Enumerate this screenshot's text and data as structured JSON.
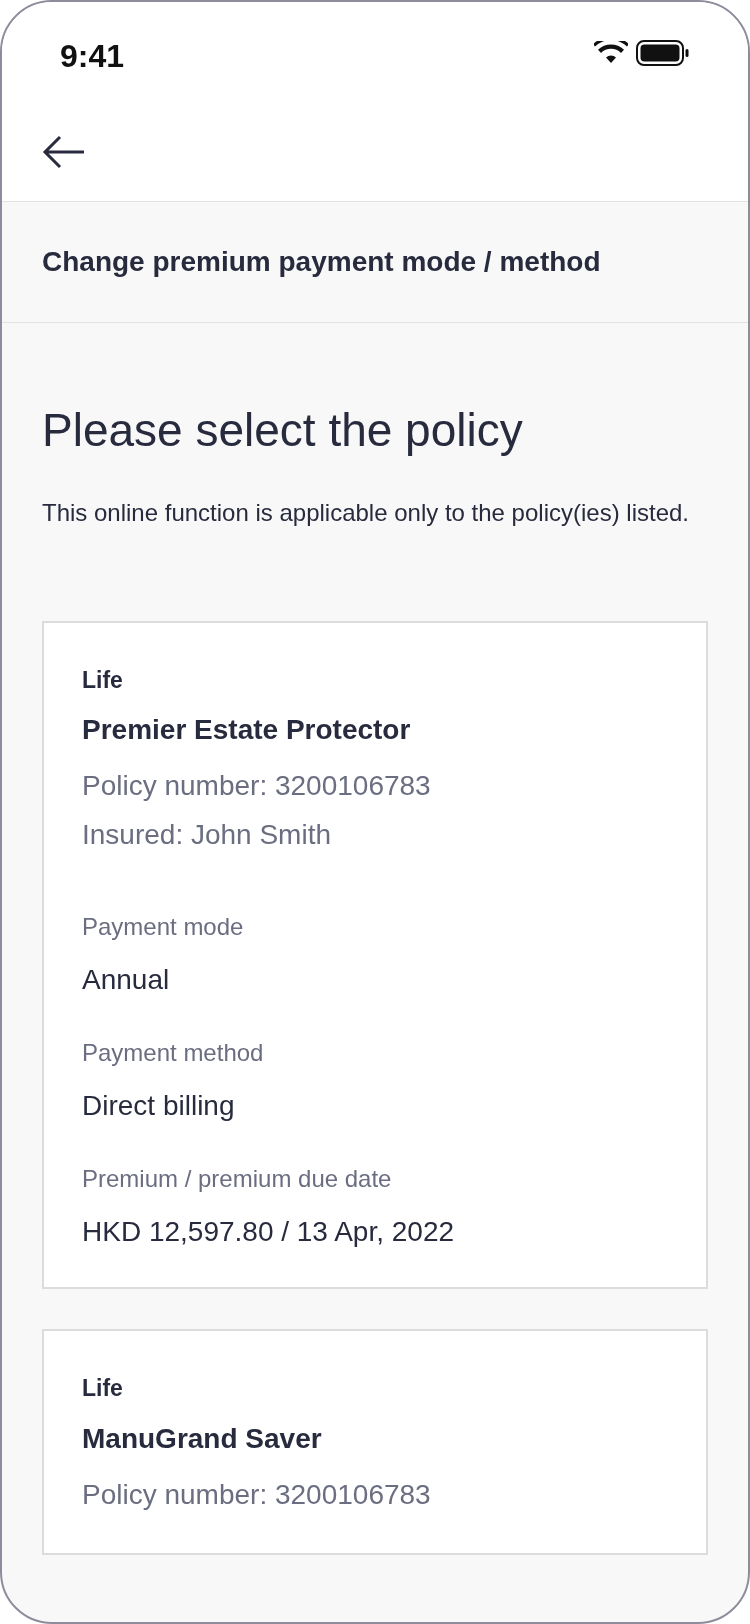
{
  "status_bar": {
    "time": "9:41"
  },
  "header": {
    "title": "Change premium payment mode / method"
  },
  "heading": "Please select the policy",
  "description": "This online function is applicable only to the policy(ies) listed.",
  "policies": [
    {
      "category": "Life",
      "name": "Premier Estate Protector",
      "policy_number": "Policy number: 3200106783",
      "insured": "Insured: John Smith",
      "fields": [
        {
          "label": "Payment mode",
          "value": "Annual"
        },
        {
          "label": "Payment method",
          "value": "Direct billing"
        },
        {
          "label": "Premium / premium due date",
          "value": "HKD 12,597.80 / 13 Apr, 2022"
        }
      ]
    },
    {
      "category": "Life",
      "name": "ManuGrand Saver",
      "policy_number": "Policy number: 3200106783"
    }
  ]
}
